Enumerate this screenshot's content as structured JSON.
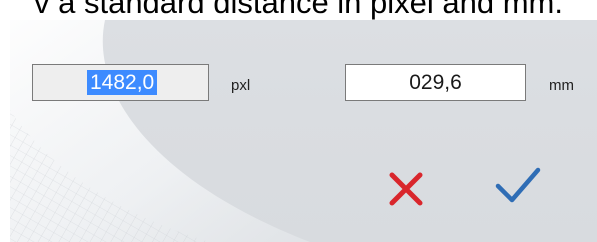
{
  "caption": "v a standard distance in pixel and mm.",
  "fields": {
    "pixels": {
      "value": "1482,0",
      "unit": "pxl"
    },
    "millimeters": {
      "value": "029,6",
      "unit": "mm"
    }
  },
  "buttons": {
    "cancel": {
      "icon": "close-icon",
      "color": "#d9262c"
    },
    "confirm": {
      "icon": "checkmark-icon",
      "color": "#2f6db5"
    }
  },
  "colors": {
    "selection": "#3d8bff",
    "dialog_background": "#dadde1"
  }
}
